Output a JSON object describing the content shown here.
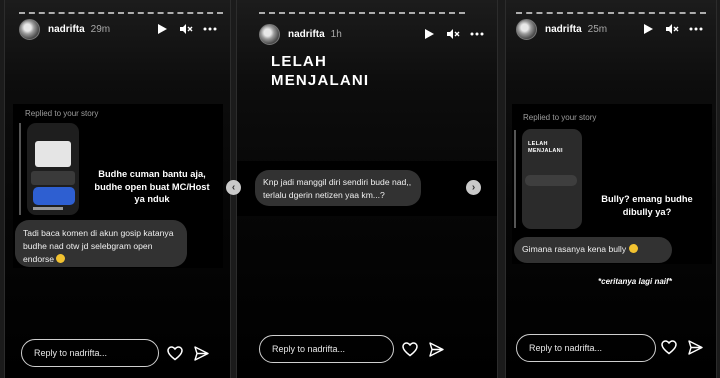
{
  "stories": [
    {
      "username": "nadrifta",
      "time": "29m",
      "replied_label": "Replied to your story",
      "caption": "Budhe cuman bantu aja, budhe open buat MC/Host ya nduk",
      "message": "Tadi baca komen di akun gosip katanya budhe nad otw jd selebgram open endorse",
      "reply_placeholder": "Reply to nadrifta..."
    },
    {
      "username": "nadrifta",
      "time": "1h",
      "title_line1": "LELAH",
      "title_line2": "MENJALANI",
      "message": "Knp jadi manggil diri sendiri bude nad,, terlalu dgerin netizen yaa km...?",
      "reply_placeholder": "Reply to nadrifta..."
    },
    {
      "username": "nadrifta",
      "time": "25m",
      "replied_label": "Replied to your story",
      "thumb_title": "LELAH MENJALANI",
      "caption": "Bully? emang budhe dibully ya?",
      "message": "Gimana rasanya kena bully",
      "footnote": "*ceritanya lagi naif*",
      "reply_placeholder": "Reply to nadrifta..."
    }
  ],
  "icons": [
    "play-icon",
    "mute-icon",
    "more-icon",
    "heart-icon",
    "send-icon",
    "chevron-left-icon",
    "chevron-right-icon"
  ],
  "colors": {
    "background": "#1b1b1b",
    "bubble": "#323232",
    "text_muted": "#a8a8a8",
    "emoji": "#f2c230"
  }
}
